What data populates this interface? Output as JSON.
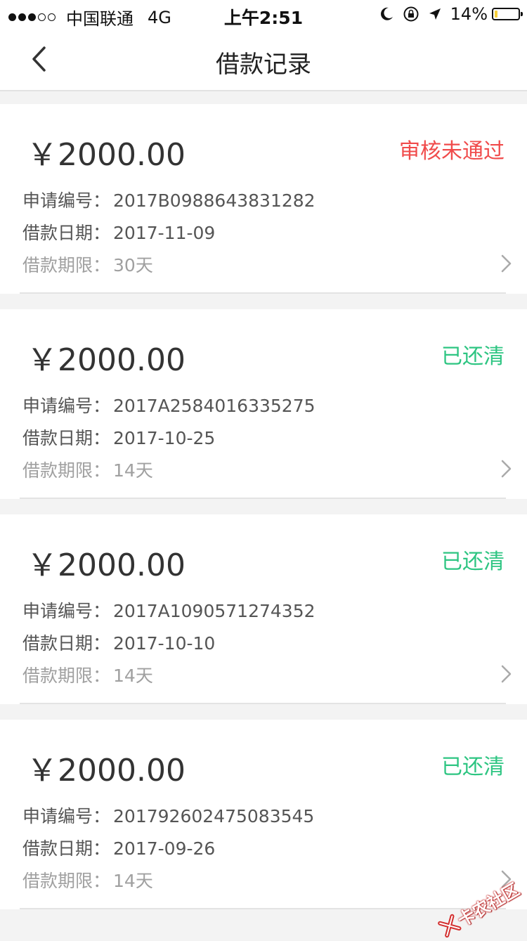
{
  "status_bar": {
    "carrier": "中国联通",
    "network": "4G",
    "time": "上午2:51",
    "battery": "14%",
    "battery_level": 0.14,
    "signal_bars": 3
  },
  "header": {
    "title": "借款记录",
    "back_icon": "chevron-left-icon"
  },
  "labels": {
    "application_no": "申请编号：",
    "loan_date": "借款日期：",
    "loan_term": "借款期限："
  },
  "records": [
    {
      "amount": "￥2000.00",
      "status": "审核未通过",
      "status_color": "#f04b4b",
      "application_no": "2017B0988643831282",
      "loan_date": "2017-11-09",
      "loan_term": "30天"
    },
    {
      "amount": "￥2000.00",
      "status": "已还清",
      "status_color": "#2ec582",
      "application_no": "2017A2584016335275",
      "loan_date": "2017-10-25",
      "loan_term": "14天"
    },
    {
      "amount": "￥2000.00",
      "status": "已还清",
      "status_color": "#2ec582",
      "application_no": "2017A1090571274352",
      "loan_date": "2017-10-10",
      "loan_term": "14天"
    },
    {
      "amount": "￥2000.00",
      "status": "已还清",
      "status_color": "#2ec582",
      "application_no": "201792602475083545",
      "loan_date": "2017-09-26",
      "loan_term": "14天"
    }
  ],
  "watermark": {
    "text": "卡农社区"
  }
}
